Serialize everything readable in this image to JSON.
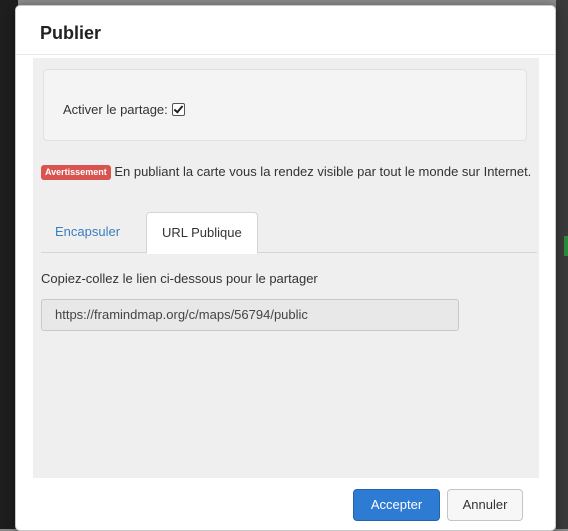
{
  "dialog": {
    "title": "Publier"
  },
  "sharing": {
    "label": "Activer le partage:",
    "checked": true
  },
  "warning": {
    "badge": "Avertissement",
    "text": "En publiant la carte vous la rendez visible par tout le monde sur Internet."
  },
  "tabs": [
    {
      "label": "Encapsuler",
      "active": false
    },
    {
      "label": "URL Publique",
      "active": true
    }
  ],
  "public_url": {
    "instruction": "Copiez-collez le lien ci-dessous pour le partager",
    "value": "https://framindmap.org/c/maps/56794/public"
  },
  "footer": {
    "accept_label": "Accepter",
    "cancel_label": "Annuler"
  },
  "colors": {
    "primary": "#2d7bd3",
    "danger": "#d9534f",
    "link": "#3a7ec0"
  }
}
